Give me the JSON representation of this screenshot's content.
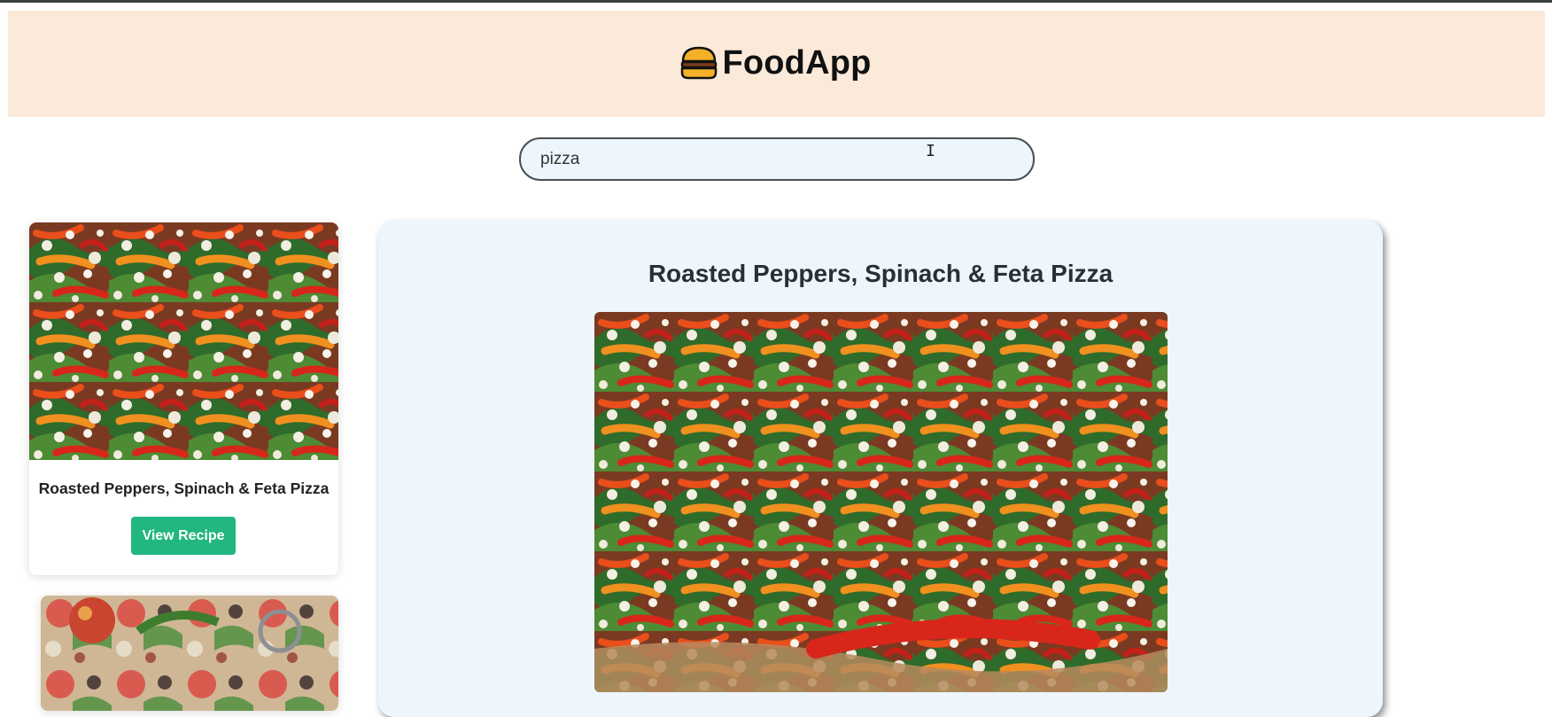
{
  "app": {
    "name": "FoodApp",
    "logo_icon": "hamburger-icon"
  },
  "search": {
    "value": "pizza"
  },
  "results": [
    {
      "title": "Roasted Peppers, Spinach & Feta Pizza",
      "button_label": "View Recipe"
    }
  ],
  "detail": {
    "title": "Roasted Peppers, Spinach & Feta Pizza"
  },
  "colors": {
    "header_bg": "#fbe9d9",
    "accent_button": "#22b680",
    "panel_bg": "#eef6fd"
  }
}
